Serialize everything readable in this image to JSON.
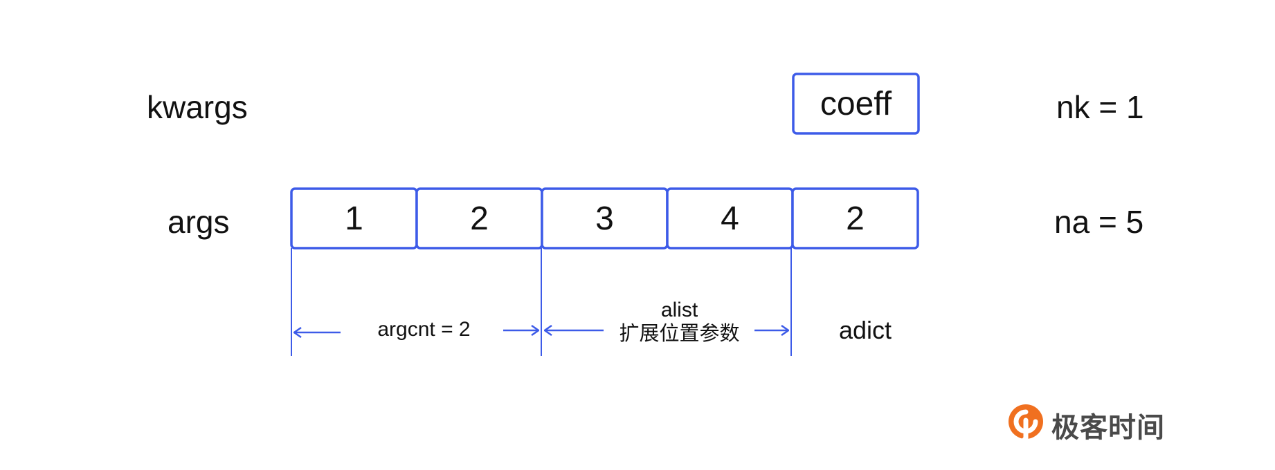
{
  "labels": {
    "kwargs": "kwargs",
    "args": "args",
    "nk": "nk = 1",
    "na": "na = 5"
  },
  "kwargs_cells": [
    "coeff"
  ],
  "args_cells": [
    "1",
    "2",
    "3",
    "4",
    "2"
  ],
  "spans": {
    "argcnt": "argcnt = 2",
    "alist": "alist",
    "alist_sub": "扩展位置参数",
    "adict": "adict"
  },
  "logo": {
    "text": "极客时间",
    "color": "#f07020"
  },
  "colors": {
    "accent": "#3d5be8",
    "text": "#111111"
  }
}
